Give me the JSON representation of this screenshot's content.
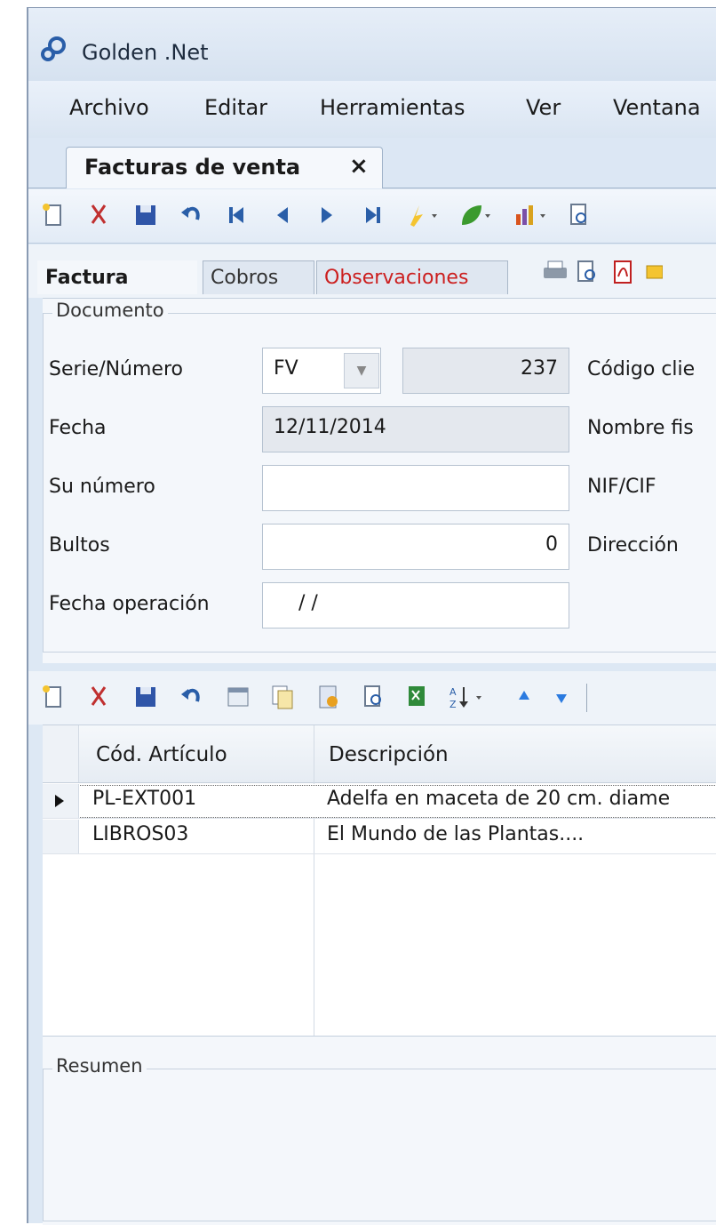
{
  "app": {
    "title": "Golden .Net"
  },
  "menu": [
    "Archivo",
    "Editar",
    "Herramientas",
    "Ver",
    "Ventana"
  ],
  "doc_tab": {
    "label": "Facturas de venta",
    "close": "×"
  },
  "sub_tabs": {
    "factura": "Factura",
    "cobros": "Cobros",
    "observaciones": "Observaciones"
  },
  "documento": {
    "group_title": "Documento",
    "serie_label": "Serie/Número",
    "serie_value": "FV",
    "numero_value": "237",
    "fecha_label": "Fecha",
    "fecha_value": "12/11/2014",
    "su_numero_label": "Su número",
    "su_numero_value": "",
    "bultos_label": "Bultos",
    "bultos_value": "0",
    "fecha_op_label": "Fecha operación",
    "fecha_op_value": "/  /",
    "codigo_label": "Código clie",
    "nombre_label": "Nombre fis",
    "nif_label": "NIF/CIF",
    "direccion_label": "Dirección"
  },
  "grid": {
    "columns": [
      "Cód. Artículo",
      "Descripción"
    ],
    "rows": [
      {
        "codigo": "PL-EXT001",
        "descripcion": "Adelfa en maceta de 20 cm. diame"
      },
      {
        "codigo": "LIBROS03",
        "descripcion": "El Mundo de las Plantas...."
      }
    ]
  },
  "resumen": {
    "title": "Resumen"
  },
  "colors": {
    "accent": "#2a5ea8",
    "observaciones": "#cc1f1f"
  }
}
